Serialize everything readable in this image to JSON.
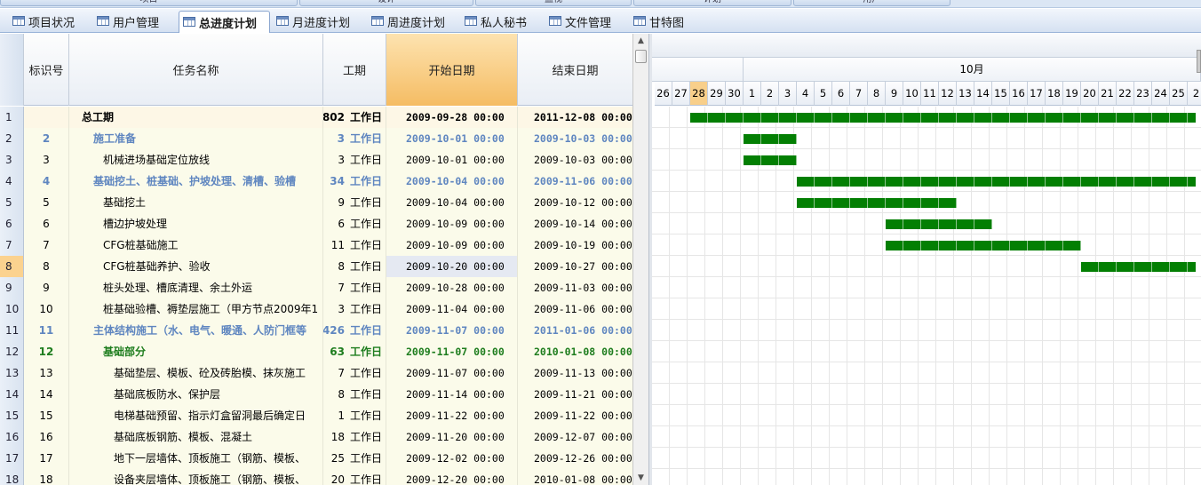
{
  "top_buttons": [
    {
      "label": "项目"
    },
    {
      "label": "设计"
    },
    {
      "label": "监视"
    },
    {
      "label": "计划"
    },
    {
      "label": "用户"
    }
  ],
  "tabs": [
    {
      "label": "项目状况",
      "active": false
    },
    {
      "label": "用户管理",
      "active": false
    },
    {
      "label": "总进度计划",
      "active": true
    },
    {
      "label": "月进度计划",
      "active": false
    },
    {
      "label": "周进度计划",
      "active": false
    },
    {
      "label": "私人秘书",
      "active": false
    },
    {
      "label": "文件管理",
      "active": false
    },
    {
      "label": "甘特图",
      "active": false
    }
  ],
  "columns": {
    "id": "标识号",
    "name": "任务名称",
    "duration": "工期",
    "start": "开始日期",
    "end": "结束日期"
  },
  "rows": [
    {
      "rn": "1",
      "id": "",
      "name": "总工期",
      "dur": "802",
      "unit": "工作日",
      "start": "2009-09-28 00:00",
      "end": "2011-12-08 00:00",
      "level": "summary"
    },
    {
      "rn": "2",
      "id": "2",
      "name": "施工准备",
      "dur": "3",
      "unit": "工作日",
      "start": "2009-10-01 00:00",
      "end": "2009-10-03 00:00",
      "level": "l1"
    },
    {
      "rn": "3",
      "id": "3",
      "name": "机械进场基础定位放线",
      "dur": "3",
      "unit": "工作日",
      "start": "2009-10-01 00:00",
      "end": "2009-10-03 00:00",
      "level": "task"
    },
    {
      "rn": "4",
      "id": "4",
      "name": "基础挖土、桩基础、护坡处理、清槽、验槽",
      "dur": "34",
      "unit": "工作日",
      "start": "2009-10-04 00:00",
      "end": "2009-11-06 00:00",
      "level": "l1"
    },
    {
      "rn": "5",
      "id": "5",
      "name": "基础挖土",
      "dur": "9",
      "unit": "工作日",
      "start": "2009-10-04 00:00",
      "end": "2009-10-12 00:00",
      "level": "task"
    },
    {
      "rn": "6",
      "id": "6",
      "name": "槽边护坡处理",
      "dur": "6",
      "unit": "工作日",
      "start": "2009-10-09 00:00",
      "end": "2009-10-14 00:00",
      "level": "task"
    },
    {
      "rn": "7",
      "id": "7",
      "name": "CFG桩基础施工",
      "dur": "11",
      "unit": "工作日",
      "start": "2009-10-09 00:00",
      "end": "2009-10-19 00:00",
      "level": "task"
    },
    {
      "rn": "8",
      "id": "8",
      "name": "CFG桩基础养护、验收",
      "dur": "8",
      "unit": "工作日",
      "start": "2009-10-20 00:00",
      "end": "2009-10-27 00:00",
      "level": "task",
      "selected": true
    },
    {
      "rn": "9",
      "id": "9",
      "name": "桩头处理、槽底清理、余土外运",
      "dur": "7",
      "unit": "工作日",
      "start": "2009-10-28 00:00",
      "end": "2009-11-03 00:00",
      "level": "task"
    },
    {
      "rn": "10",
      "id": "10",
      "name": "桩基础验槽、褥垫层施工（甲方节点2009年1",
      "dur": "3",
      "unit": "工作日",
      "start": "2009-11-04 00:00",
      "end": "2009-11-06 00:00",
      "level": "task"
    },
    {
      "rn": "11",
      "id": "11",
      "name": "主体结构施工（水、电气、暖通、人防门框等",
      "dur": "426",
      "unit": "工作日",
      "start": "2009-11-07 00:00",
      "end": "2011-01-06 00:00",
      "level": "l1"
    },
    {
      "rn": "12",
      "id": "12",
      "name": "基础部分",
      "dur": "63",
      "unit": "工作日",
      "start": "2009-11-07 00:00",
      "end": "2010-01-08 00:00",
      "level": "l2"
    },
    {
      "rn": "13",
      "id": "13",
      "name": "基础垫层、模板、砼及砖胎模、抹灰施工",
      "dur": "7",
      "unit": "工作日",
      "start": "2009-11-07 00:00",
      "end": "2009-11-13 00:00",
      "level": "task"
    },
    {
      "rn": "14",
      "id": "14",
      "name": "基础底板防水、保护层",
      "dur": "8",
      "unit": "工作日",
      "start": "2009-11-14 00:00",
      "end": "2009-11-21 00:00",
      "level": "task"
    },
    {
      "rn": "15",
      "id": "15",
      "name": "电梯基础预留、指示灯盒留洞最后确定日",
      "dur": "1",
      "unit": "工作日",
      "start": "2009-11-22 00:00",
      "end": "2009-11-22 00:00",
      "level": "task"
    },
    {
      "rn": "16",
      "id": "16",
      "name": "基础底板钢筋、模板、混凝土",
      "dur": "18",
      "unit": "工作日",
      "start": "2009-11-20 00:00",
      "end": "2009-12-07 00:00",
      "level": "task"
    },
    {
      "rn": "17",
      "id": "17",
      "name": "地下一层墙体、顶板施工（钢筋、模板、",
      "dur": "25",
      "unit": "工作日",
      "start": "2009-12-02 00:00",
      "end": "2009-12-26 00:00",
      "level": "task"
    },
    {
      "rn": "18",
      "id": "18",
      "name": "设备夹层墙体、顶板施工（钢筋、模板、",
      "dur": "20",
      "unit": "工作日",
      "start": "2009-12-20 00:00",
      "end": "2010-01-08 00:00",
      "level": "task"
    }
  ],
  "gantt": {
    "month_label": "10月",
    "days": [
      "26",
      "27",
      "28",
      "29",
      "30",
      "1",
      "2",
      "3",
      "4",
      "5",
      "6",
      "7",
      "8",
      "9",
      "10",
      "11",
      "12",
      "13",
      "14",
      "15",
      "16",
      "17",
      "18",
      "19",
      "20",
      "21",
      "22",
      "23",
      "24",
      "25",
      "2"
    ],
    "today_label": "28",
    "bar_color": "#037f03"
  }
}
